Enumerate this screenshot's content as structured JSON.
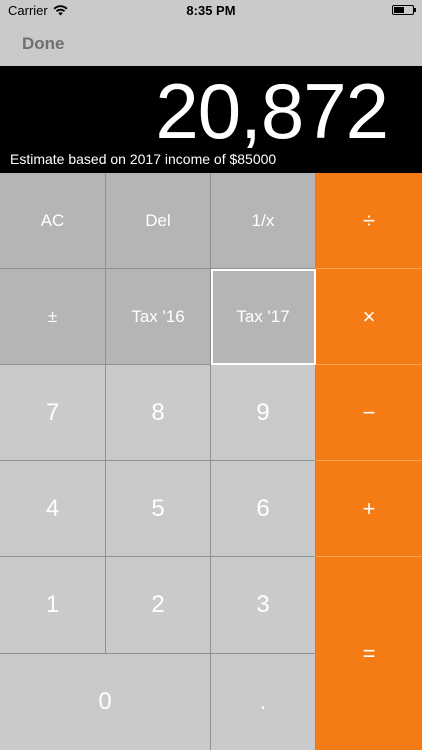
{
  "status_bar": {
    "carrier": "Carrier",
    "time": "8:35 PM",
    "wifi_icon": "wifi-icon",
    "battery_icon": "battery-icon"
  },
  "nav": {
    "done_label": "Done"
  },
  "display": {
    "value": "20,872",
    "note": "Estimate based on 2017 income of $85000"
  },
  "keys": {
    "ac": "AC",
    "del": "Del",
    "reciprocal": "1/x",
    "divide": "÷",
    "plus_minus": "±",
    "tax16": "Tax '16",
    "tax17": "Tax '17",
    "multiply": "×",
    "seven": "7",
    "eight": "8",
    "nine": "9",
    "minus": "−",
    "four": "4",
    "five": "5",
    "six": "6",
    "plus": "+",
    "one": "1",
    "two": "2",
    "three": "3",
    "equals": "=",
    "zero": "0",
    "decimal": "."
  },
  "colors": {
    "operator": "#f57c14",
    "function_key": "#b4b5b6",
    "number_key": "#c9cacc",
    "display_bg": "#000000"
  }
}
